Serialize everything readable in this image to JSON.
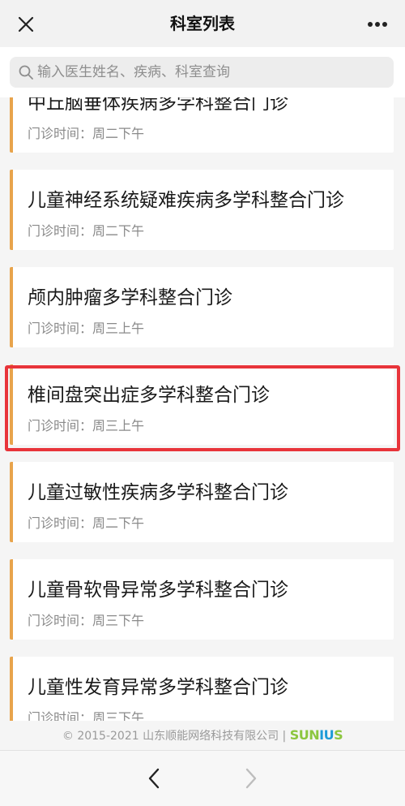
{
  "header": {
    "title": "科室列表",
    "close_icon": "close-icon",
    "more_icon": "more-icon"
  },
  "search": {
    "placeholder": "输入医生姓名、疾病、科室查询",
    "value": ""
  },
  "departments": [
    {
      "name": "中丘脑垂体疾病多学科整合门诊",
      "time": "门诊时间：周二下午"
    },
    {
      "name": "儿童神经系统疑难疾病多学科整合门诊",
      "time": "门诊时间：周二下午"
    },
    {
      "name": "颅内肿瘤多学科整合门诊",
      "time": "门诊时间：周三上午"
    },
    {
      "name": "椎间盘突出症多学科整合门诊",
      "time": "门诊时间：周三上午"
    },
    {
      "name": "儿童过敏性疾病多学科整合门诊",
      "time": "门诊时间：周二下午"
    },
    {
      "name": "儿童骨软骨异常多学科整合门诊",
      "time": "门诊时间：周三下午"
    },
    {
      "name": "儿童性发育异常多学科整合门诊",
      "time": "门诊时间：周三下午"
    }
  ],
  "highlighted_index": 3,
  "footer": {
    "copyright": "© 2015-2021 山东顺能网络科技有限公司 |",
    "logo_text": "SUNIUS"
  },
  "colors": {
    "accent": "#e8a44c",
    "highlight": "#e8343a",
    "logo_green": "#8cc63f",
    "logo_blue": "#1d9bd7"
  }
}
